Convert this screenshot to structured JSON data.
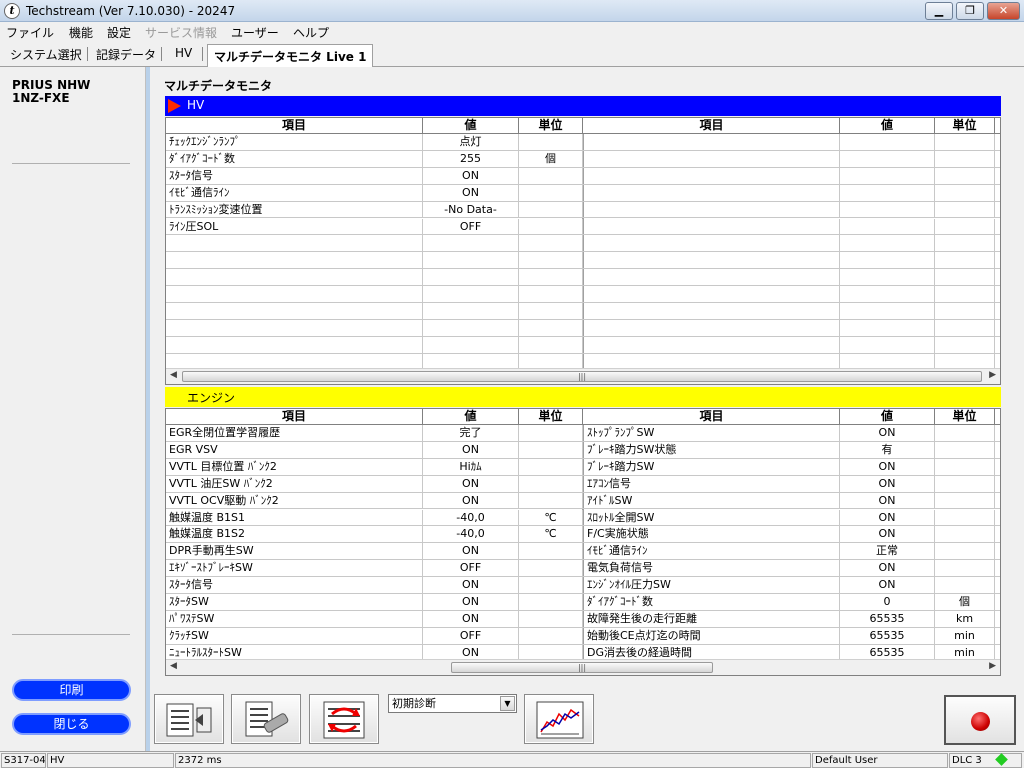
{
  "window": {
    "title": "Techstream (Ver 7.10.030) - 20247",
    "app_icon_letter": "t",
    "minimize_icon": "minimize-icon",
    "maximize_icon": "restore-icon",
    "close_icon": "close-icon"
  },
  "menu": {
    "items": [
      "ファイル",
      "機能",
      "設定",
      "サービス情報",
      "ユーザー",
      "ヘルプ"
    ],
    "disabled_index": 3
  },
  "tabs": [
    "システム選択",
    "記録データ",
    "HV",
    "マルチデータモニタ Live 1"
  ],
  "sidebar": {
    "vehicle_model": "PRIUS NHW",
    "engine": "1NZ-FXE",
    "print_button": "印刷",
    "close_button": "閉じる"
  },
  "main": {
    "title": "マルチデータモニタ",
    "columns": {
      "item": "項目",
      "value": "値",
      "unit": "単位"
    }
  },
  "hv_section": {
    "name": "HV",
    "bar_color": "#0000ff",
    "left_rows": [
      {
        "item": "ﾁｪｯｸｴﾝｼﾞﾝﾗﾝﾌﾟ",
        "value": "点灯",
        "unit": ""
      },
      {
        "item": "ﾀﾞｲｱｸﾞｺｰﾄﾞ数",
        "value": "255",
        "unit": "個"
      },
      {
        "item": "ｽﾀｰﾀ信号",
        "value": "ON",
        "unit": ""
      },
      {
        "item": "ｲﾓﾋﾞ通信ﾗｲﾝ",
        "value": "ON",
        "unit": ""
      },
      {
        "item": "ﾄﾗﾝｽﾐｯｼｮﾝ変速位置",
        "value": "-No Data-",
        "unit": ""
      },
      {
        "item": "ﾗｲﾝ圧SOL",
        "value": "OFF",
        "unit": ""
      }
    ],
    "right_rows": []
  },
  "engine_section": {
    "name": "エンジン",
    "bar_color": "#ffff00",
    "left_rows": [
      {
        "item": "EGR全閉位置学習履歴",
        "value": "完了",
        "unit": ""
      },
      {
        "item": "EGR VSV",
        "value": "ON",
        "unit": ""
      },
      {
        "item": "VVTL 目標位置 ﾊﾞﾝｸ2",
        "value": "Hiｶﾑ",
        "unit": ""
      },
      {
        "item": "VVTL 油圧SW ﾊﾞﾝｸ2",
        "value": "ON",
        "unit": ""
      },
      {
        "item": "VVTL OCV駆動 ﾊﾞﾝｸ2",
        "value": "ON",
        "unit": ""
      },
      {
        "item": "触媒温度 B1S1",
        "value": "-40,0",
        "unit": "℃"
      },
      {
        "item": "触媒温度 B1S2",
        "value": "-40,0",
        "unit": "℃"
      },
      {
        "item": "DPR手動再生SW",
        "value": "ON",
        "unit": ""
      },
      {
        "item": "ｴｷｿﾞｰｽﾄﾌﾞﾚｰｷSW",
        "value": "OFF",
        "unit": ""
      },
      {
        "item": "ｽﾀｰﾀ信号",
        "value": "ON",
        "unit": ""
      },
      {
        "item": "ｽﾀｰﾀSW",
        "value": "ON",
        "unit": ""
      },
      {
        "item": "ﾊﾟﾜｽﾃSW",
        "value": "ON",
        "unit": ""
      },
      {
        "item": "ｸﾗｯﾁSW",
        "value": "OFF",
        "unit": ""
      },
      {
        "item": "ﾆｭｰﾄﾗﾙｽﾀｰﾄSW",
        "value": "ON",
        "unit": ""
      }
    ],
    "right_rows": [
      {
        "item": "ｽﾄｯﾌﾟﾗﾝﾌﾟSW",
        "value": "ON",
        "unit": ""
      },
      {
        "item": "ﾌﾞﾚｰｷ踏力SW状態",
        "value": "有",
        "unit": ""
      },
      {
        "item": "ﾌﾞﾚｰｷ踏力SW",
        "value": "ON",
        "unit": ""
      },
      {
        "item": "ｴｱｺﾝ信号",
        "value": "ON",
        "unit": ""
      },
      {
        "item": "ｱｲﾄﾞﾙSW",
        "value": "ON",
        "unit": ""
      },
      {
        "item": "ｽﾛｯﾄﾙ全開SW",
        "value": "ON",
        "unit": ""
      },
      {
        "item": "F/C実施状態",
        "value": "ON",
        "unit": ""
      },
      {
        "item": "ｲﾓﾋﾞ通信ﾗｲﾝ",
        "value": "正常",
        "unit": ""
      },
      {
        "item": "電気負荷信号",
        "value": "ON",
        "unit": ""
      },
      {
        "item": "ｴﾝｼﾞﾝｵｲﾙ圧力SW",
        "value": "ON",
        "unit": ""
      },
      {
        "item": "ﾀﾞｲｱｸﾞｺｰﾄﾞ数",
        "value": "0",
        "unit": "個"
      },
      {
        "item": "故障発生後の走行距離",
        "value": "65535",
        "unit": "km"
      },
      {
        "item": "始動後CE点灯迄の時間",
        "value": "65535",
        "unit": "min"
      },
      {
        "item": "DG消去後の経過時間",
        "value": "65535",
        "unit": "min"
      }
    ]
  },
  "toolbar": {
    "buttons": [
      "list-edit-icon",
      "data-list-icon",
      "swap-icon",
      "graph-icon"
    ],
    "dropdown_value": "初期診断",
    "record_icon": "record-icon"
  },
  "statusbar": {
    "code": "S317-04",
    "system": "HV",
    "time": "2372 ms",
    "user": "Default User",
    "connection": "DLC 3",
    "connection_color": "#22cc22"
  }
}
